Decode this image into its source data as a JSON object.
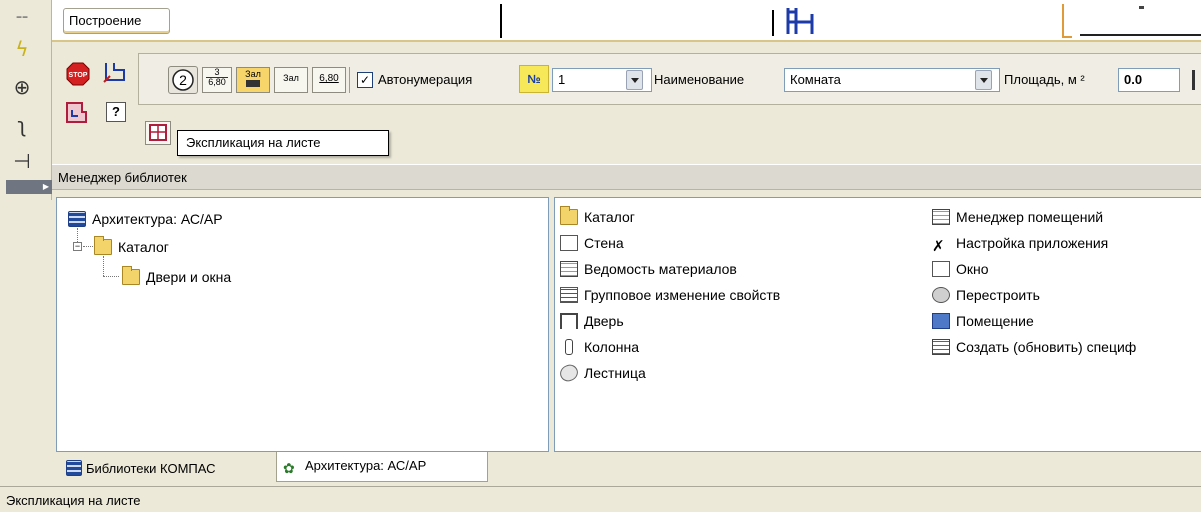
{
  "top": {
    "construction_tab": "Построение"
  },
  "toolbar": {
    "fraction_top": "3",
    "fraction_bottom": "6,80",
    "zal_label": "Зал",
    "zal_label2": "Зал",
    "value_680": "6,80",
    "autonumber_label": "Автонумерация",
    "number_badge": "№",
    "number_value": "1",
    "name_label": "Наименование",
    "name_value": "Комната",
    "area_label": "Площадь, м ²",
    "area_value": "0.0"
  },
  "tooltip": "Экспликация на листе",
  "library_manager": {
    "title": "Менеджер библиотек",
    "tree": [
      "Архитектура: АС/АР",
      "Каталог",
      "Двери и окна"
    ],
    "col1": [
      "Каталог",
      "Стена",
      "Ведомость материалов",
      "Групповое изменение свойств",
      "Дверь",
      "Колонна",
      "Лестница"
    ],
    "col2": [
      "Менеджер помещений",
      "Настройка приложения",
      "Окно",
      "Перестроить",
      "Помещение",
      "Создать (обновить) специф"
    ],
    "tabs": [
      "Библиотеки КОМПАС",
      "Архитектура: АС/АР"
    ]
  },
  "status": "Экспликация на листе",
  "colors": {
    "chrome": "#ece9d8",
    "field_border": "#7f9db9",
    "badge": "#f7e85a",
    "folder": "#f3d46a"
  }
}
